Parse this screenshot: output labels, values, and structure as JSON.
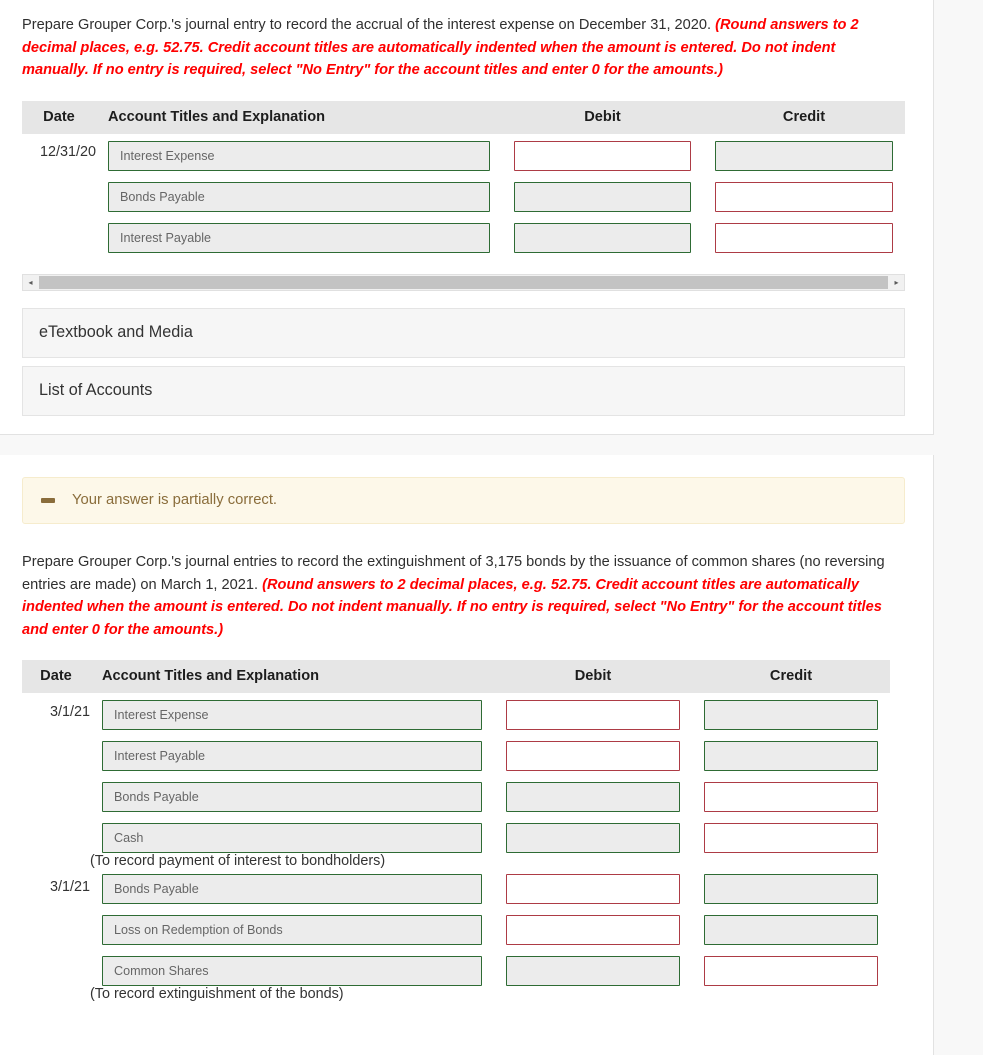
{
  "colors": {
    "page_bg": "#f8f8f8",
    "card_bg": "#ffffff",
    "table_header_bg": "#e6e6e6",
    "field_disabled_bg": "#ececec",
    "border_green": "#2e6b34",
    "border_red": "#ad3b45",
    "required_text": "#ff0000",
    "banner_bg": "#fdf8e9",
    "banner_text": "#8a6d3b"
  },
  "part_one": {
    "prompt_main": "Prepare Grouper Corp.'s journal entry to record the accrual of the interest expense on December 31, 2020. ",
    "prompt_required": "(Round answers to 2 decimal places, e.g. 52.75. Credit account titles are automatically indented when the amount is entered. Do not indent manually. If no entry is required, select \"No Entry\" for the account titles and enter 0 for the amounts.)",
    "table": {
      "headers": {
        "date": "Date",
        "account": "Account Titles and Explanation",
        "debit": "Debit",
        "credit": "Credit"
      },
      "rows": [
        {
          "date": "12/31/20",
          "account": "Interest Expense",
          "account_state": "disabled",
          "debit": "",
          "debit_state": "active",
          "credit": "",
          "credit_state": "disabled"
        },
        {
          "date": "",
          "account": "Bonds Payable",
          "account_state": "disabled",
          "debit": "",
          "debit_state": "disabled",
          "credit": "",
          "credit_state": "active"
        },
        {
          "date": "",
          "account": "Interest Payable",
          "account_state": "disabled",
          "debit": "",
          "debit_state": "disabled",
          "credit": "",
          "credit_state": "active"
        }
      ]
    },
    "scrollbar": {
      "left_arrow": "◂",
      "right_arrow": "▸"
    },
    "panels": [
      {
        "label": "eTextbook and Media"
      },
      {
        "label": "List of Accounts"
      }
    ]
  },
  "part_two": {
    "banner": {
      "icon": "minus-dash-icon",
      "text": "Your answer is partially correct."
    },
    "prompt_main": "Prepare Grouper Corp.'s journal entries to record the extinguishment of 3,175 bonds by the issuance of common shares (no reversing entries are made) on March 1, 2021. ",
    "prompt_required": "(Round answers to 2 decimal places, e.g. 52.75. Credit account titles are automatically indented when the amount is entered. Do not indent manually. If no entry is required, select \"No Entry\" for the account titles and enter 0 for the amounts.)",
    "table": {
      "headers": {
        "date": "Date",
        "account": "Account Titles and Explanation",
        "debit": "Debit",
        "credit": "Credit"
      },
      "rows": [
        {
          "type": "entry",
          "date": "3/1/21",
          "account": "Interest Expense",
          "account_state": "disabled",
          "debit": "",
          "debit_state": "active",
          "credit": "",
          "credit_state": "disabled"
        },
        {
          "type": "entry",
          "date": "",
          "account": "Interest Payable",
          "account_state": "disabled",
          "debit": "",
          "debit_state": "active",
          "credit": "",
          "credit_state": "disabled"
        },
        {
          "type": "entry",
          "date": "",
          "account": "Bonds Payable",
          "account_state": "disabled",
          "debit": "",
          "debit_state": "disabled",
          "credit": "",
          "credit_state": "active"
        },
        {
          "type": "entry",
          "date": "",
          "account": "Cash",
          "account_state": "disabled",
          "debit": "",
          "debit_state": "disabled",
          "credit": "",
          "credit_state": "active"
        },
        {
          "type": "memo",
          "memo": "(To record payment of interest to bondholders)"
        },
        {
          "type": "entry",
          "date": "3/1/21",
          "account": "Bonds Payable",
          "account_state": "disabled",
          "debit": "",
          "debit_state": "active",
          "credit": "",
          "credit_state": "disabled"
        },
        {
          "type": "entry",
          "date": "",
          "account": "Loss on Redemption of Bonds",
          "account_state": "disabled",
          "debit": "",
          "debit_state": "active",
          "credit": "",
          "credit_state": "disabled"
        },
        {
          "type": "entry",
          "date": "",
          "account": "Common Shares",
          "account_state": "disabled",
          "debit": "",
          "debit_state": "disabled",
          "credit": "",
          "credit_state": "active"
        },
        {
          "type": "memo",
          "memo": "(To record extinguishment of the bonds)"
        }
      ]
    }
  }
}
